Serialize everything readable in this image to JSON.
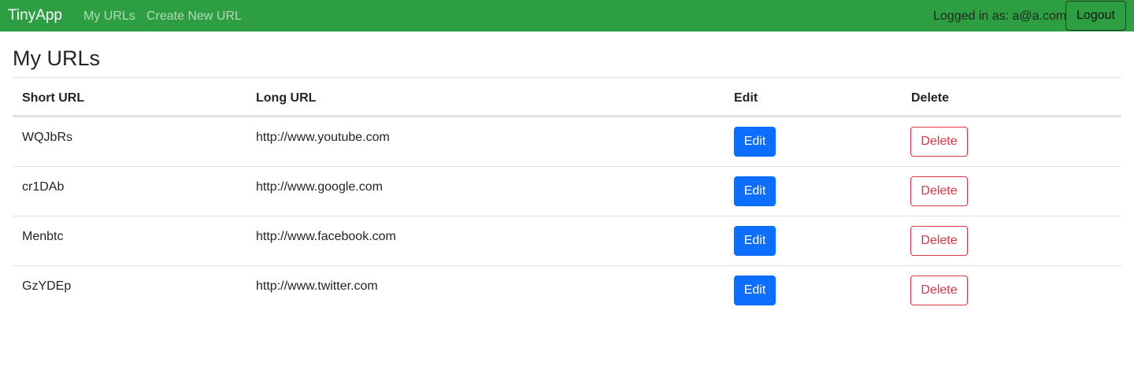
{
  "nav": {
    "brand": "TinyApp",
    "links": [
      "My URLs",
      "Create New URL"
    ],
    "logged_in_text": "Logged in as: a@a.com",
    "logout_label": "Logout"
  },
  "colors": {
    "navbar": "#2e9e43",
    "primary": "#0d6efd",
    "danger": "#dc3545"
  },
  "main": {
    "title": "My URLs",
    "table": {
      "headers": [
        "Short URL",
        "Long URL",
        "Edit",
        "Delete"
      ],
      "rows": [
        {
          "short": "WQJbRs",
          "long": "http://www.youtube.com",
          "edit": "Edit",
          "delete": "Delete"
        },
        {
          "short": "cr1DAb",
          "long": "http://www.google.com",
          "edit": "Edit",
          "delete": "Delete"
        },
        {
          "short": "Menbtc",
          "long": "http://www.facebook.com",
          "edit": "Edit",
          "delete": "Delete"
        },
        {
          "short": "GzYDEp",
          "long": "http://www.twitter.com",
          "edit": "Edit",
          "delete": "Delete"
        }
      ]
    }
  }
}
